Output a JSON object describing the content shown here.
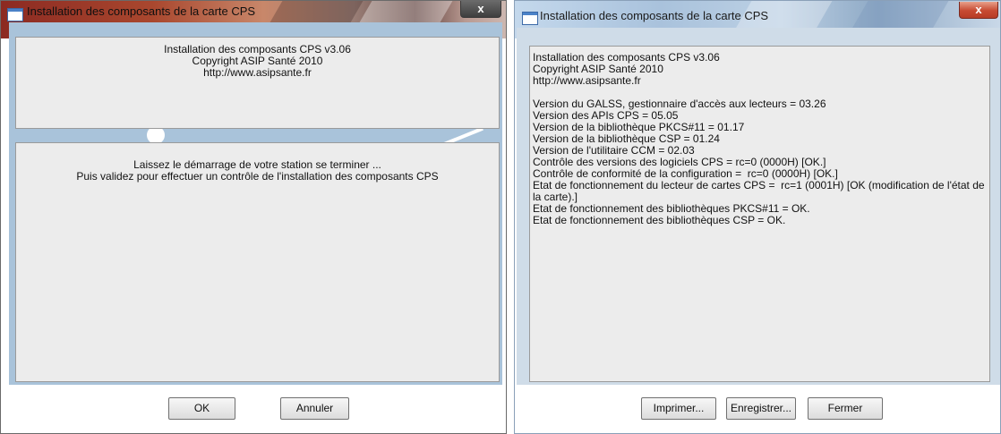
{
  "left_window": {
    "title": "Installation des composants de la carte CPS",
    "close_label": "x",
    "header_lines": [
      "Installation des composants CPS v3.06",
      "Copyright ASIP Santé 2010",
      "http://www.asipsante.fr"
    ],
    "message_lines": [
      "Laissez le démarrage de votre station se terminer ...",
      "Puis validez pour effectuer un contrôle de l'installation des composants CPS"
    ],
    "buttons": {
      "ok": "OK",
      "cancel": "Annuler"
    }
  },
  "right_window": {
    "title": "Installation des composants de la carte CPS",
    "close_label": "x",
    "log_lines": [
      "Installation des composants CPS v3.06",
      "Copyright ASIP Santé 2010",
      "http://www.asipsante.fr",
      "",
      "Version du GALSS, gestionnaire d'accès aux lecteurs = 03.26",
      "Version des APIs CPS = 05.05",
      "Version de la bibliothèque PKCS#11 = 01.17",
      "Version de la bibliothèque CSP = 01.24",
      "Version de l'utilitaire CCM = 02.03",
      "Contrôle des versions des logiciels CPS = rc=0 (0000H) [OK.]",
      "Contrôle de conformité de la configuration =  rc=0 (0000H) [OK.]",
      "Etat de fonctionnement du lecteur de cartes CPS =  rc=1 (0001H) [OK (modification de l'état de la carte).]",
      "Etat de fonctionnement des bibliothèques PKCS#11 = OK.",
      "Etat de fonctionnement des bibliothèques CSP = OK."
    ],
    "buttons": {
      "print": "Imprimer...",
      "save": "Enregistrer...",
      "close": "Fermer"
    }
  }
}
